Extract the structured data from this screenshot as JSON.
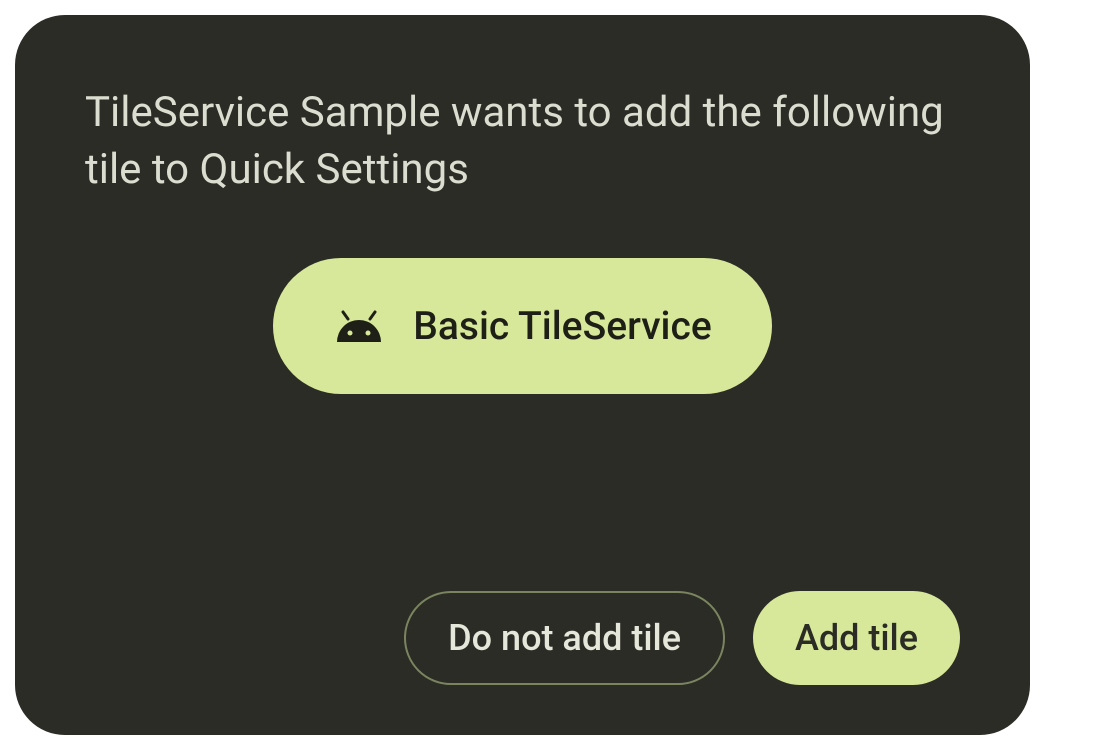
{
  "dialog": {
    "message": "TileService Sample wants to add the following tile to Quick Settings",
    "tile": {
      "label": "Basic TileService",
      "icon": "android-icon"
    },
    "buttons": {
      "deny_label": "Do not add tile",
      "accept_label": "Add tile"
    }
  },
  "colors": {
    "dialog_bg": "#2b2c25",
    "accent": "#d7e89a",
    "text_primary": "#dbddd0",
    "text_on_accent": "#1e2017",
    "outline": "#7a8560"
  }
}
